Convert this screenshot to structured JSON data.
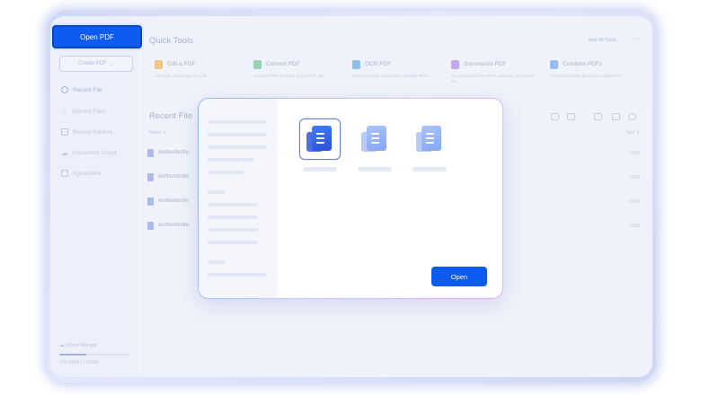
{
  "sidebar": {
    "open_pdf": "Open PDF",
    "create_pdf": "Create PDF",
    "items": [
      {
        "label": "Recent File"
      },
      {
        "label": "Starred Files"
      },
      {
        "label": "Recent Folders"
      },
      {
        "label": "Document Cloud"
      },
      {
        "label": "Agreement"
      }
    ],
    "storage_label": "Cloud Storage",
    "storage_used": "778.04KB / 1.00GB",
    "storage_fraction": 0.38
  },
  "quick_tools": {
    "title": "Quick Tools",
    "see_all": "See All Tools",
    "more": "···",
    "tools": [
      {
        "name": "Edit a PDF",
        "desc": "Edit texts and images in a file.",
        "color": "#f2b24a"
      },
      {
        "name": "Convert PDF",
        "desc": "Convert PDFs to Word, Excel, PPT, etc.",
        "color": "#6fbf8e"
      },
      {
        "name": "OCR PDF",
        "desc": "Turn scans into searchable, editable PDFs.",
        "color": "#5fa5e0"
      },
      {
        "name": "Summarize PDF",
        "desc": "AI summarizes the PDF's overview, key points, etc.",
        "color": "#a888e8"
      },
      {
        "name": "Combine PDFs",
        "desc": "Combine multiple files into a single PDF.",
        "color": "#6f9ef0"
      }
    ]
  },
  "recent": {
    "title": "Recent File",
    "col_name": "Name",
    "col_size": "Size",
    "rows": [
      {
        "name": "texttexttextte",
        "size": "102M"
      },
      {
        "name": "texttexttextte",
        "size": "102M"
      },
      {
        "name": "texttexttextte",
        "size": "102M"
      },
      {
        "name": "texttexttextte",
        "size": "102M"
      }
    ]
  },
  "modal": {
    "open_button": "Open",
    "accent": "#0d5cf0"
  }
}
